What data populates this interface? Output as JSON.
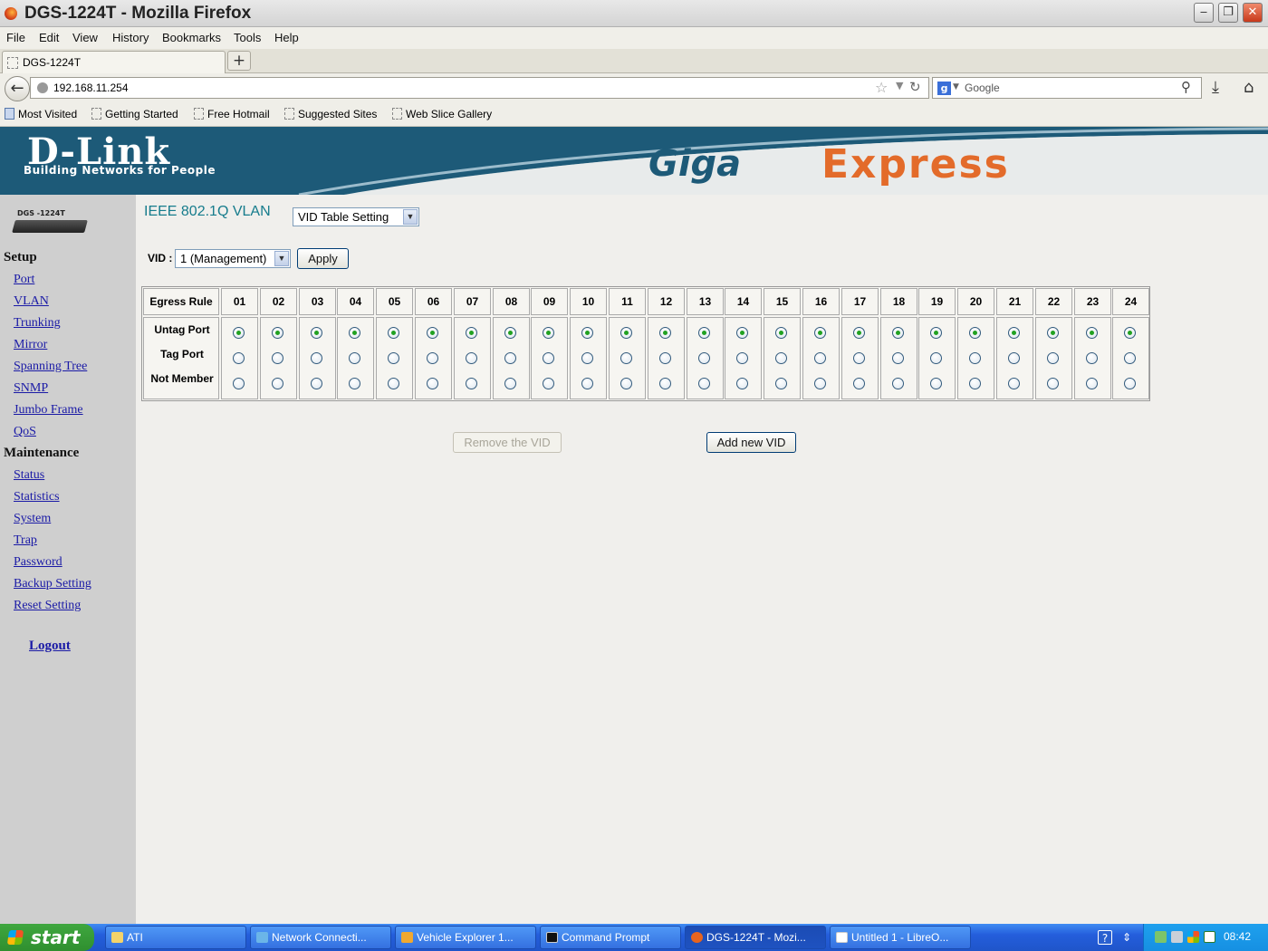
{
  "window": {
    "title": "DGS-1224T - Mozilla Firefox"
  },
  "menu": [
    "File",
    "Edit",
    "View",
    "History",
    "Bookmarks",
    "Tools",
    "Help"
  ],
  "tab": {
    "label": "DGS-1224T"
  },
  "nav": {
    "url": "192.168.11.254",
    "search_placeholder": "Google"
  },
  "bookmarks": [
    "Most Visited",
    "Getting Started",
    "Free Hotmail",
    "Suggested Sites",
    "Web Slice Gallery"
  ],
  "banner": {
    "logo": "D-Link",
    "tagline": "Building Networks for People",
    "giga": "Giga",
    "express": "Express"
  },
  "device": {
    "label": "DGS -1224T"
  },
  "sidebar": {
    "setup_heading": "Setup",
    "setup_links": [
      "Port",
      "VLAN",
      "Trunking",
      "Mirror",
      "Spanning Tree",
      "SNMP",
      "Jumbo Frame",
      "QoS"
    ],
    "maintenance_heading": "Maintenance",
    "maintenance_links": [
      "Status",
      "Statistics",
      "System",
      "Trap",
      "Password",
      "Backup Setting",
      "Reset Setting"
    ],
    "logout": "Logout"
  },
  "main": {
    "title": "IEEE 802.1Q VLAN",
    "mode_select": "VID Table Setting",
    "vid_label": "VID :",
    "vid_select": "1  (Management)",
    "apply_button": "Apply",
    "table": {
      "header_label": "Egress Rule",
      "ports": [
        "01",
        "02",
        "03",
        "04",
        "05",
        "06",
        "07",
        "08",
        "09",
        "10",
        "11",
        "12",
        "13",
        "14",
        "15",
        "16",
        "17",
        "18",
        "19",
        "20",
        "21",
        "22",
        "23",
        "24"
      ],
      "rows": [
        "Untag Port",
        "Tag Port",
        "Not Member"
      ],
      "selected_row": "Untag Port"
    },
    "remove_button": "Remove the VID",
    "add_button": "Add new VID"
  },
  "taskbar": {
    "start": "start",
    "tasks": [
      "ATI",
      "Network Connecti...",
      "Vehicle Explorer 1...",
      "Command Prompt",
      "DGS-1224T - Mozi...",
      "Untitled 1 - LibreO..."
    ],
    "active_task": "DGS-1224T - Mozi...",
    "clock": "08:42"
  }
}
